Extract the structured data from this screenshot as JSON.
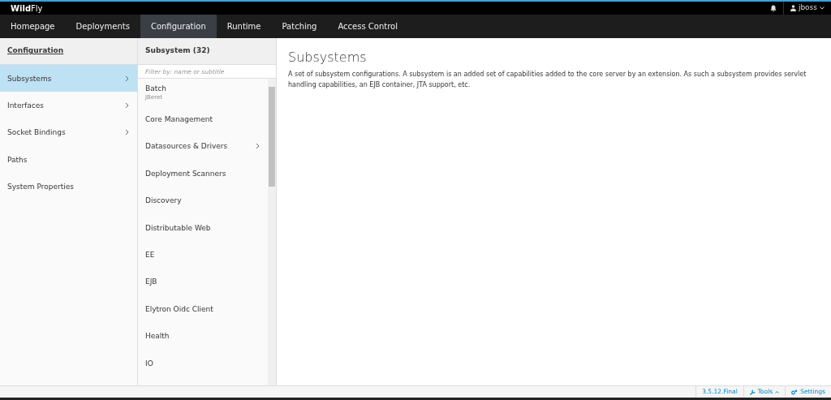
{
  "brand": "**Wild**Fly",
  "user": {
    "name": "jboss"
  },
  "nav": [
    {
      "label": "Homepage",
      "selected": false
    },
    {
      "label": "Deployments",
      "selected": false
    },
    {
      "label": "Configuration",
      "selected": true
    },
    {
      "label": "Runtime",
      "selected": false
    },
    {
      "label": "Patching",
      "selected": false
    },
    {
      "label": "Access Control",
      "selected": false
    }
  ],
  "column_1": {
    "title": "Configuration",
    "items": [
      {
        "label": "Subsystems",
        "selected": true,
        "has_children": true
      },
      {
        "label": "Interfaces",
        "selected": false,
        "has_children": true
      },
      {
        "label": "Socket Bindings",
        "selected": false,
        "has_children": true
      },
      {
        "label": "Paths",
        "selected": false,
        "has_children": false
      },
      {
        "label": "System Properties",
        "selected": false,
        "has_children": false
      }
    ]
  },
  "column_2": {
    "title": "Subsystem (32)",
    "filter": {
      "placeholder": "Filter by: name or subtitle"
    },
    "items": [
      {
        "label": "Batch",
        "subtitle": "JBeret",
        "selected": false,
        "has_children": false
      },
      {
        "label": "Core Management",
        "selected": false,
        "has_children": false
      },
      {
        "label": "Datasources & Drivers",
        "selected": false,
        "has_children": true
      },
      {
        "label": "Deployment Scanners",
        "selected": false,
        "has_children": false
      },
      {
        "label": "Discovery",
        "selected": false,
        "has_children": false
      },
      {
        "label": "Distributable Web",
        "selected": false,
        "has_children": false
      },
      {
        "label": "EE",
        "selected": false,
        "has_children": false
      },
      {
        "label": "EJB",
        "selected": false,
        "has_children": false
      },
      {
        "label": "Elytron Oidc Client",
        "selected": false,
        "has_children": false
      },
      {
        "label": "Health",
        "selected": false,
        "has_children": false
      },
      {
        "label": "IO",
        "selected": false,
        "has_children": false
      }
    ]
  },
  "preview": {
    "title": "Subsystems",
    "text": "A set of subsystem configurations. A subsystem is an added set of capabilities added to the core server by an extension. As such a subsystem provides servlet handling capabilities, an EJB container, JTA support, etc."
  },
  "footer": {
    "version": "3.5.12.Final",
    "tools": "Tools",
    "settings": "Settings"
  }
}
